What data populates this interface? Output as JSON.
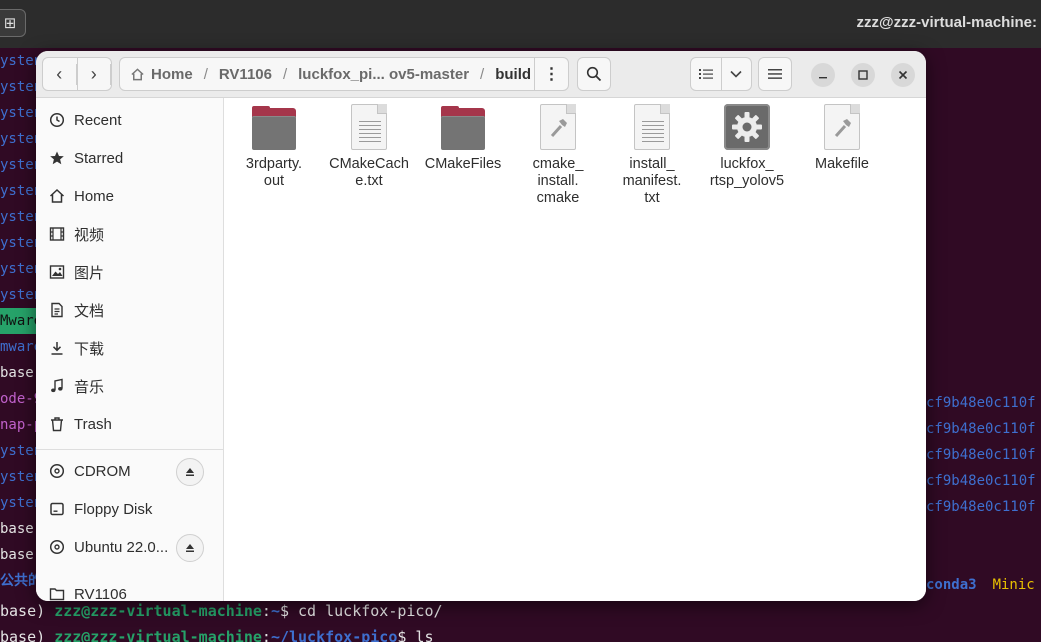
{
  "terminal": {
    "title": "zzz@zzz-virtual-machine:",
    "left_lines": [
      "ysten",
      "ysten",
      "ysten",
      "ysten",
      "ysten",
      "ysten",
      "ysten",
      "ysten",
      "ysten",
      "ysten",
      "Mware",
      "mware",
      "base)",
      "ode-9",
      "nap-p",
      "ysten",
      "ysten",
      "ysten",
      "base)",
      "base)",
      "公共的"
    ],
    "right_lines": [
      "cf9b48e0c110f",
      "cf9b48e0c110f",
      "cf9b48e0c110f",
      "cf9b48e0c110f",
      "cf9b48e0c110f"
    ],
    "right_extra": {
      "a": "conda3",
      "b": "Minic"
    },
    "cmd1": {
      "prefix": "base)",
      "user": "zzz@zzz-virtual-machine",
      "path": "~",
      "cmd": "$ cd luckfox-pico/"
    },
    "cmd2": {
      "prefix": "base)",
      "user": "zzz@zzz-virtual-machine",
      "path": "~/luckfox-pico",
      "cmd": "$ ls"
    }
  },
  "filemanager": {
    "path": {
      "home": "Home",
      "segments": [
        "RV1106",
        "luckfox_pi... ov5-master"
      ],
      "current": "build"
    },
    "sidebar": {
      "items": [
        {
          "label": "Recent",
          "icon": "clock-icon"
        },
        {
          "label": "Starred",
          "icon": "star-icon"
        },
        {
          "label": "Home",
          "icon": "home-icon"
        },
        {
          "label": "视频",
          "icon": "video-icon"
        },
        {
          "label": "图片",
          "icon": "image-icon"
        },
        {
          "label": "文档",
          "icon": "document-icon"
        },
        {
          "label": "下载",
          "icon": "download-icon"
        },
        {
          "label": "音乐",
          "icon": "music-icon"
        },
        {
          "label": "Trash",
          "icon": "trash-icon"
        }
      ],
      "devices": [
        {
          "label": "CDROM",
          "icon": "disc-icon",
          "eject": true
        },
        {
          "label": "Floppy Disk",
          "icon": "drive-icon",
          "eject": false
        },
        {
          "label": "Ubuntu 22.0...",
          "icon": "disc-icon",
          "eject": true
        },
        {
          "label": "RV1106",
          "icon": "folder-icon",
          "eject": false
        }
      ]
    },
    "files": [
      {
        "name": "3rdparty.\nout",
        "type": "folder"
      },
      {
        "name": "CMakeCach\ne.txt",
        "type": "text"
      },
      {
        "name": "CMakeFiles",
        "type": "folder"
      },
      {
        "name": "cmake_\ninstall.\ncmake",
        "type": "script"
      },
      {
        "name": "install_\nmanifest.\ntxt",
        "type": "text"
      },
      {
        "name": "luckfox_\nrtsp_yolov5",
        "type": "executable"
      },
      {
        "name": "Makefile",
        "type": "script"
      }
    ]
  }
}
